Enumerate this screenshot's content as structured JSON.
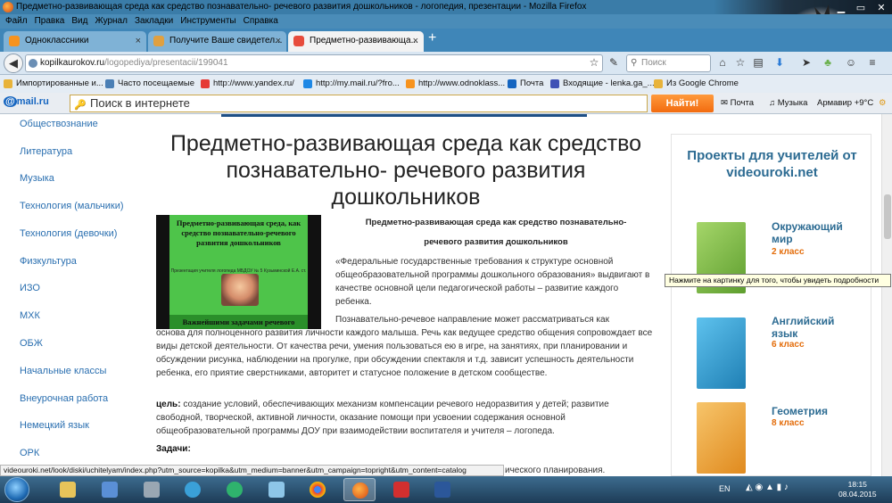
{
  "window": {
    "title": "Предметно-развивающая среда как средство познавательно- речевого развития дошкольников - логопедия, презентации - Mozilla Firefox"
  },
  "menu": [
    "Файл",
    "Правка",
    "Вид",
    "Журнал",
    "Закладки",
    "Инструменты",
    "Справка"
  ],
  "tabs": [
    {
      "label": "Одноклассники",
      "icon": "odnoklassniki-icon",
      "color": "#f7931e"
    },
    {
      "label": "Получите Ваше свидетел...",
      "icon": "page-icon",
      "color": "#e0a040"
    },
    {
      "label": "Предметно-развивающа...",
      "icon": "kopilka-icon",
      "color": "#e74c3c",
      "active": true
    }
  ],
  "nav": {
    "url_host": "kopilkaurokov.ru",
    "url_path": "/logopediya/presentacii/199041",
    "search_placeholder": "Поиск"
  },
  "bookmarks": [
    {
      "label": "Импортированные и...",
      "color": "#e8b33a"
    },
    {
      "label": "Часто посещаемые",
      "color": "#4a7fb5"
    },
    {
      "label": "http://www.yandex.ru/",
      "color": "#e53935"
    },
    {
      "label": "http://my.mail.ru/?fro...",
      "color": "#1e88e5"
    },
    {
      "label": "http://www.odnoklass...",
      "color": "#f7931e"
    },
    {
      "label": "Почта",
      "color": "#1565c0"
    },
    {
      "label": "Входящие - lenka.ga_...",
      "color": "#3f51b5"
    },
    {
      "label": "Из Google Chrome",
      "color": "#e8b33a"
    }
  ],
  "mailru": {
    "logo_at": "@",
    "logo_text": "mail.ru",
    "search_placeholder": "Поиск в интернете",
    "find_button": "Найти!",
    "mail_link": "Почта",
    "music_link": "Музыка",
    "weather": "Армавир +9°C"
  },
  "sidebar": [
    "Обществознание",
    "Литература",
    "Музыка",
    "Технология (мальчики)",
    "Технология (девочки)",
    "Физкультура",
    "ИЗО",
    "МХК",
    "ОБЖ",
    "Начальные классы",
    "Внеурочная работа",
    "Немецкий язык",
    "ОРК"
  ],
  "page": {
    "title": "Предметно-развивающая среда как средство познавательно- речевого развития дошкольников",
    "slide": {
      "title": "Предметно-развивающая среда, как средство познавательно-речевого развития дошкольников",
      "small": "Презентация учителя логопеда МБДОУ № 5 Кузьминской Е.А. ст. Отрадная 2014г",
      "bar": "Важнейшими задачами речевого"
    },
    "heading1": "Предметно-развивающая среда как средство познавательно-",
    "heading2": "речевого развития дошкольников",
    "para1": "«Федеральные государственные требования к структуре основной общеобразовательной программы дошкольного образования» выдвигают в качестве основной цели педагогической работы – развитие каждого ребенка.",
    "para2_a": "Познавательно-речевое направление может рассматриваться как",
    "para2_b": "основа для полноценного развития личности каждого малыша. Речь как ведущее средство общения сопровождает все виды детской деятельности. От качества речи, умения пользоваться ею в игре, на занятиях, при планировании и обсуждении рисунка, наблюдении на прогулке, при обсуждении спектакля и т.д. зависит успешность деятельности ребенка, его приятие сверстниками, авторитет и статусное положение в детском сообществе.",
    "goal_label": "цель:",
    "goal_text": " создание условий, обеспечивающих механизм компенсации речевого недоразвития у детей; развитие свободной, творческой, активной личности, оказание помощи при усвоении содержания основной общеобразовательной программы ДОУ при взаимодействии воспитателя и учителя – логопеда.",
    "tasks_label": "Задачи:",
    "under_status": "ического планирования."
  },
  "ad": {
    "title": "Проекты для учителей от videouroki.net",
    "items": [
      {
        "name": "Окружающий мир",
        "grade": "2 класс",
        "color": "#8bc34a"
      },
      {
        "name": "Английский язык",
        "grade": "6 класс",
        "color": "#29a0d8"
      },
      {
        "name": "Геометрия",
        "grade": "8 класс",
        "color": "#f0a030"
      }
    ]
  },
  "tooltip": "Нажмите на картинку для того, чтобы увидеть подробности",
  "status_url": "videouroki.net/look/diski/uchitelyam/index.php?utm_source=kopilka&utm_medium=banner&utm_campaign=topright&utm_content=catalog",
  "taskbar": {
    "apps": [
      {
        "name": "explorer-icon",
        "color": "#e8c45a"
      },
      {
        "name": "network-icon",
        "color": "#5a8fd6"
      },
      {
        "name": "files-icon",
        "color": "#9aa7b3"
      },
      {
        "name": "globe-icon",
        "color": "#3aa0d8"
      },
      {
        "name": "agent-icon",
        "color": "#2fb36d"
      },
      {
        "name": "window-icon",
        "color": "#8ec6e8"
      },
      {
        "name": "chrome-icon",
        "color": "#e53935"
      },
      {
        "name": "firefox-icon",
        "color": "#f57c00"
      },
      {
        "name": "avira-icon",
        "color": "#d32f2f"
      },
      {
        "name": "word-icon",
        "color": "#2b579a"
      }
    ],
    "lang": "EN",
    "time": "18:15",
    "date": "08.04.2015"
  }
}
